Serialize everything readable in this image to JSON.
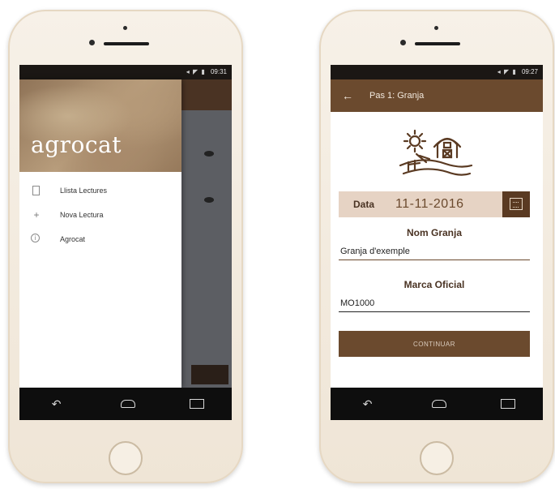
{
  "phone_left": {
    "status": {
      "icons": "◂ ◤ ▮",
      "time": "09:31"
    },
    "drawer": {
      "title": "agrocat",
      "items": [
        {
          "icon": "list-icon",
          "label": "Llista Lectures"
        },
        {
          "icon": "plus-icon",
          "label": "Nova Lectura"
        },
        {
          "icon": "info-icon",
          "label": "Agrocat"
        }
      ]
    }
  },
  "phone_right": {
    "status": {
      "icons": "◂ ◤ ▮",
      "time": "09:27"
    },
    "toolbar": {
      "back_icon": "arrow-back-icon",
      "title": "Pas 1: Granja"
    },
    "date": {
      "label": "Data",
      "value": "11-11-2016",
      "icon": "calendar-icon"
    },
    "fields": {
      "farm_name": {
        "label": "Nom Granja",
        "value": "Granja d'exemple"
      },
      "official_mark": {
        "label": "Marca Oficial",
        "value": "MO1000"
      }
    },
    "continue_label": "CONTINUAR"
  },
  "colors": {
    "brand_brown": "#6b4a2e",
    "date_bg": "#e6d3c4",
    "dark_bar": "#0e0e0e"
  }
}
